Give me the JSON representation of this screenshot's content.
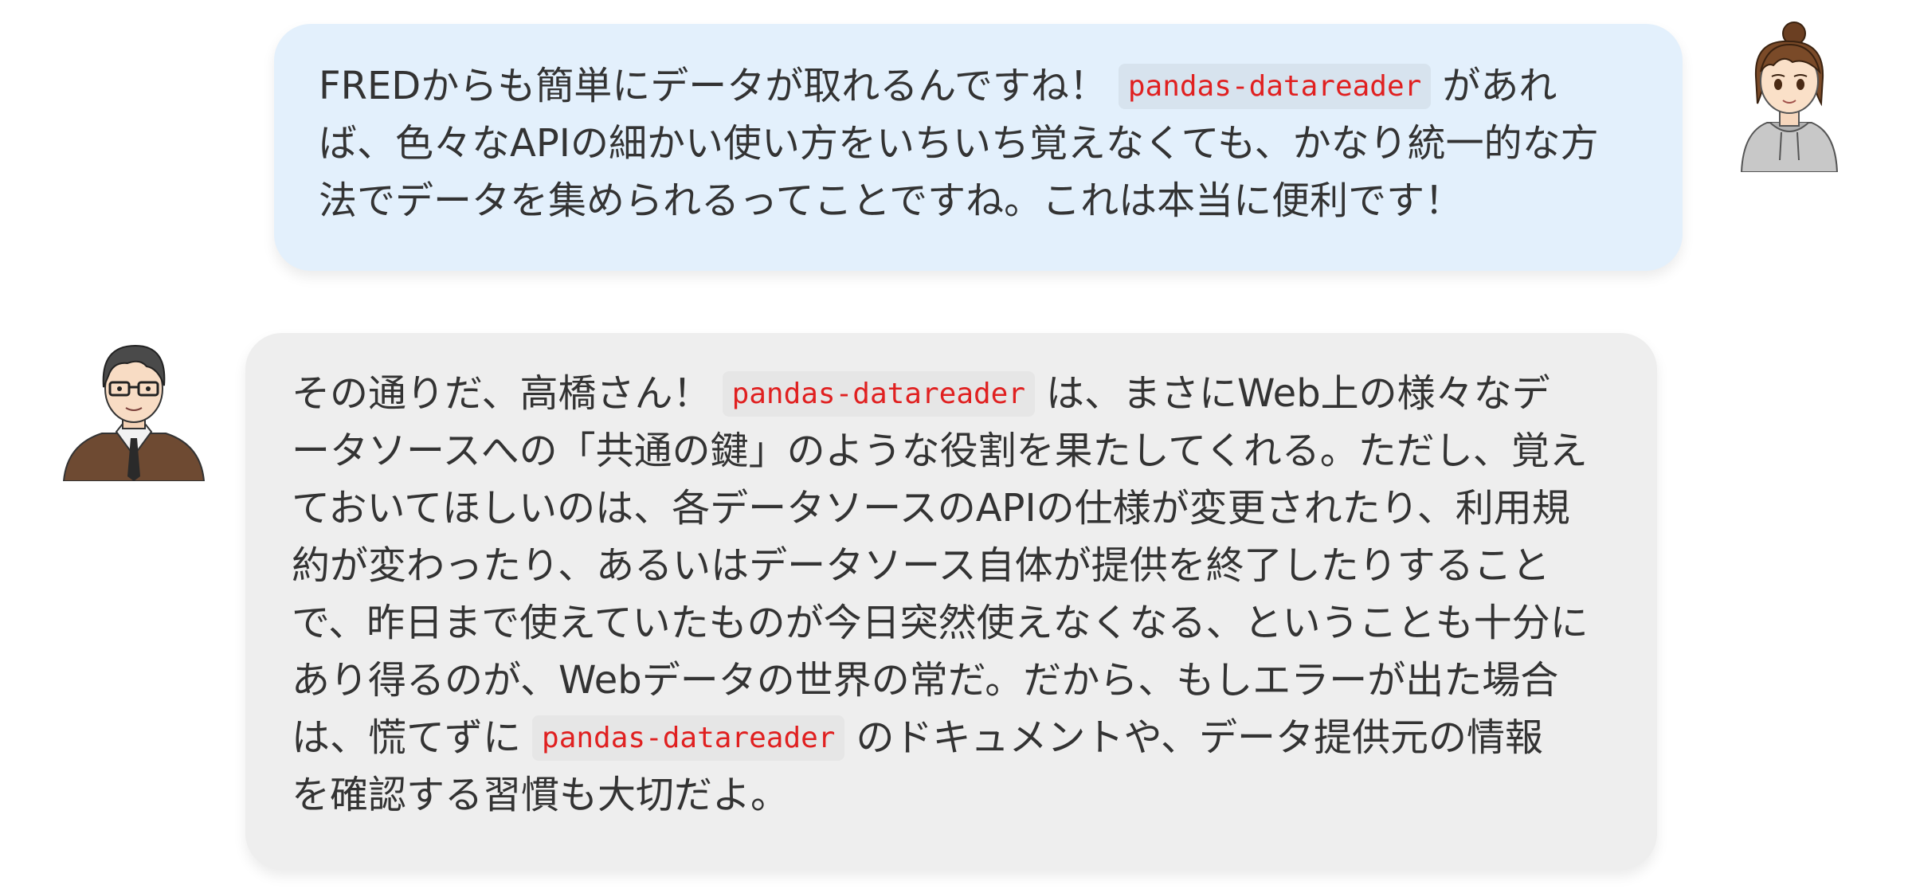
{
  "messages": [
    {
      "speaker": "student",
      "lines": [
        {
          "before": "FREDからも簡単にデータが取れるんですね！",
          "code": "pandas-datareader",
          "after": "があれ"
        },
        {
          "before": "ば、色々なAPIの細かい使い方をいちいち覚えなくても、かなり統一的な方"
        },
        {
          "before": "法でデータを集められるってことですね。これは本当に便利です！"
        }
      ]
    },
    {
      "speaker": "teacher",
      "lines": [
        {
          "before": "その通りだ、高橋さん！",
          "code": "pandas-datareader",
          "after": "は、まさにWeb上の様々なデ"
        },
        {
          "before": "ータソースへの「共通の鍵」のような役割を果たしてくれる。ただし、覚え"
        },
        {
          "before": "ておいてほしいのは、各データソースのAPIの仕様が変更されたり、利用規"
        },
        {
          "before": "約が変わったり、あるいはデータソース自体が提供を終了したりすること"
        },
        {
          "before": "で、昨日まで使えていたものが今日突然使えなくなる、ということも十分に"
        },
        {
          "before": "あり得るのが、Webデータの世界の常だ。だから、もしエラーが出た場合"
        },
        {
          "before": "は、慌てずに",
          "code": "pandas-datareader",
          "after": "のドキュメントや、データ提供元の情報"
        },
        {
          "before": "を確認する習慣も大切だよ。"
        }
      ]
    }
  ],
  "colors": {
    "student_bubble": "#e3f0fc",
    "teacher_bubble": "#eeeeee",
    "code_text": "#e02020"
  },
  "icons": {
    "student_avatar": "woman-avatar-icon",
    "teacher_avatar": "man-avatar-icon"
  }
}
